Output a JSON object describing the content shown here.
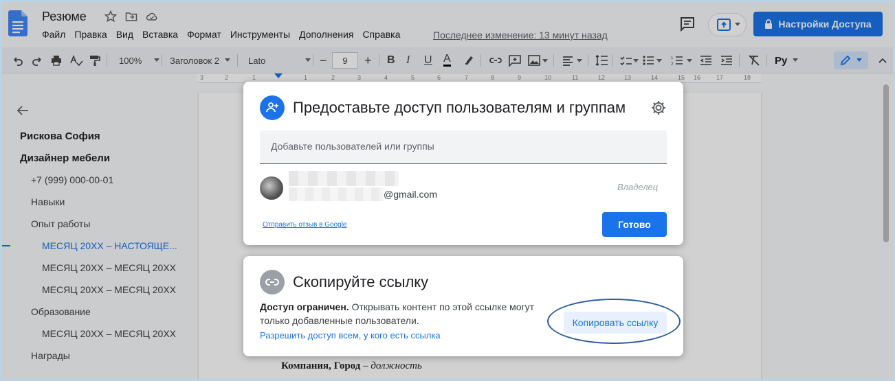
{
  "header": {
    "doc_title": "Резюме",
    "menu": [
      "Файл",
      "Правка",
      "Вид",
      "Вставка",
      "Формат",
      "Инструменты",
      "Дополнения",
      "Справка"
    ],
    "last_edit": "Последнее изменение: 13 минут назад",
    "share_label": "Настройки Доступа"
  },
  "toolbar": {
    "zoom": "100%",
    "style": "Заголовок 2",
    "font": "Lato",
    "font_size": "9",
    "lang": "Ру"
  },
  "ruler": [
    "3",
    "2",
    "1",
    "1",
    "2",
    "3",
    "4",
    "5",
    "6",
    "7",
    "8",
    "9",
    "10",
    "11",
    "12",
    "13",
    "14",
    "15",
    "16",
    "17",
    "18"
  ],
  "outline": {
    "items": [
      {
        "label": "Рискова София",
        "level": 1
      },
      {
        "label": "Дизайнер мебели",
        "level": 1
      },
      {
        "label": "+7 (999) 000-00-01",
        "level": 2
      },
      {
        "label": "Навыки",
        "level": 2
      },
      {
        "label": "Опыт работы",
        "level": 2
      },
      {
        "label": "МЕСЯЦ 20ХХ – НАСТОЯЩЕ...",
        "level": 3
      },
      {
        "label": "МЕСЯЦ 20ХХ – МЕСЯЦ 20ХХ",
        "level": 3
      },
      {
        "label": "МЕСЯЦ 20ХХ – МЕСЯЦ 20ХХ",
        "level": 3
      },
      {
        "label": "Образование",
        "level": 2
      },
      {
        "label": "МЕСЯЦ 20ХХ – МЕСЯЦ 20ХХ",
        "level": 3
      },
      {
        "label": "Награды",
        "level": 2
      }
    ]
  },
  "page": {
    "company": "Компания, Город",
    "dash": " – ",
    "position": "должность"
  },
  "share_dialog": {
    "title": "Предоставьте доступ пользователям и группам",
    "add_placeholder": "Добавьте пользователей или группы",
    "email_suffix": "@gmail.com",
    "role": "Владелец",
    "feedback_link": "Отправить отзыв в Google",
    "done_label": "Готово"
  },
  "link_dialog": {
    "title": "Скопируйте ссылку",
    "access_bold": "Доступ ограничен.",
    "access_text": " Открывать контент по этой ссылке могут только добавленные пользователи.",
    "allow_link": "Разрешить доступ всем, у кого есть ссылка",
    "copy_label": "Копировать ссылку"
  },
  "colors": {
    "accent": "#1a73e8",
    "ring": "#2c5f9e"
  }
}
